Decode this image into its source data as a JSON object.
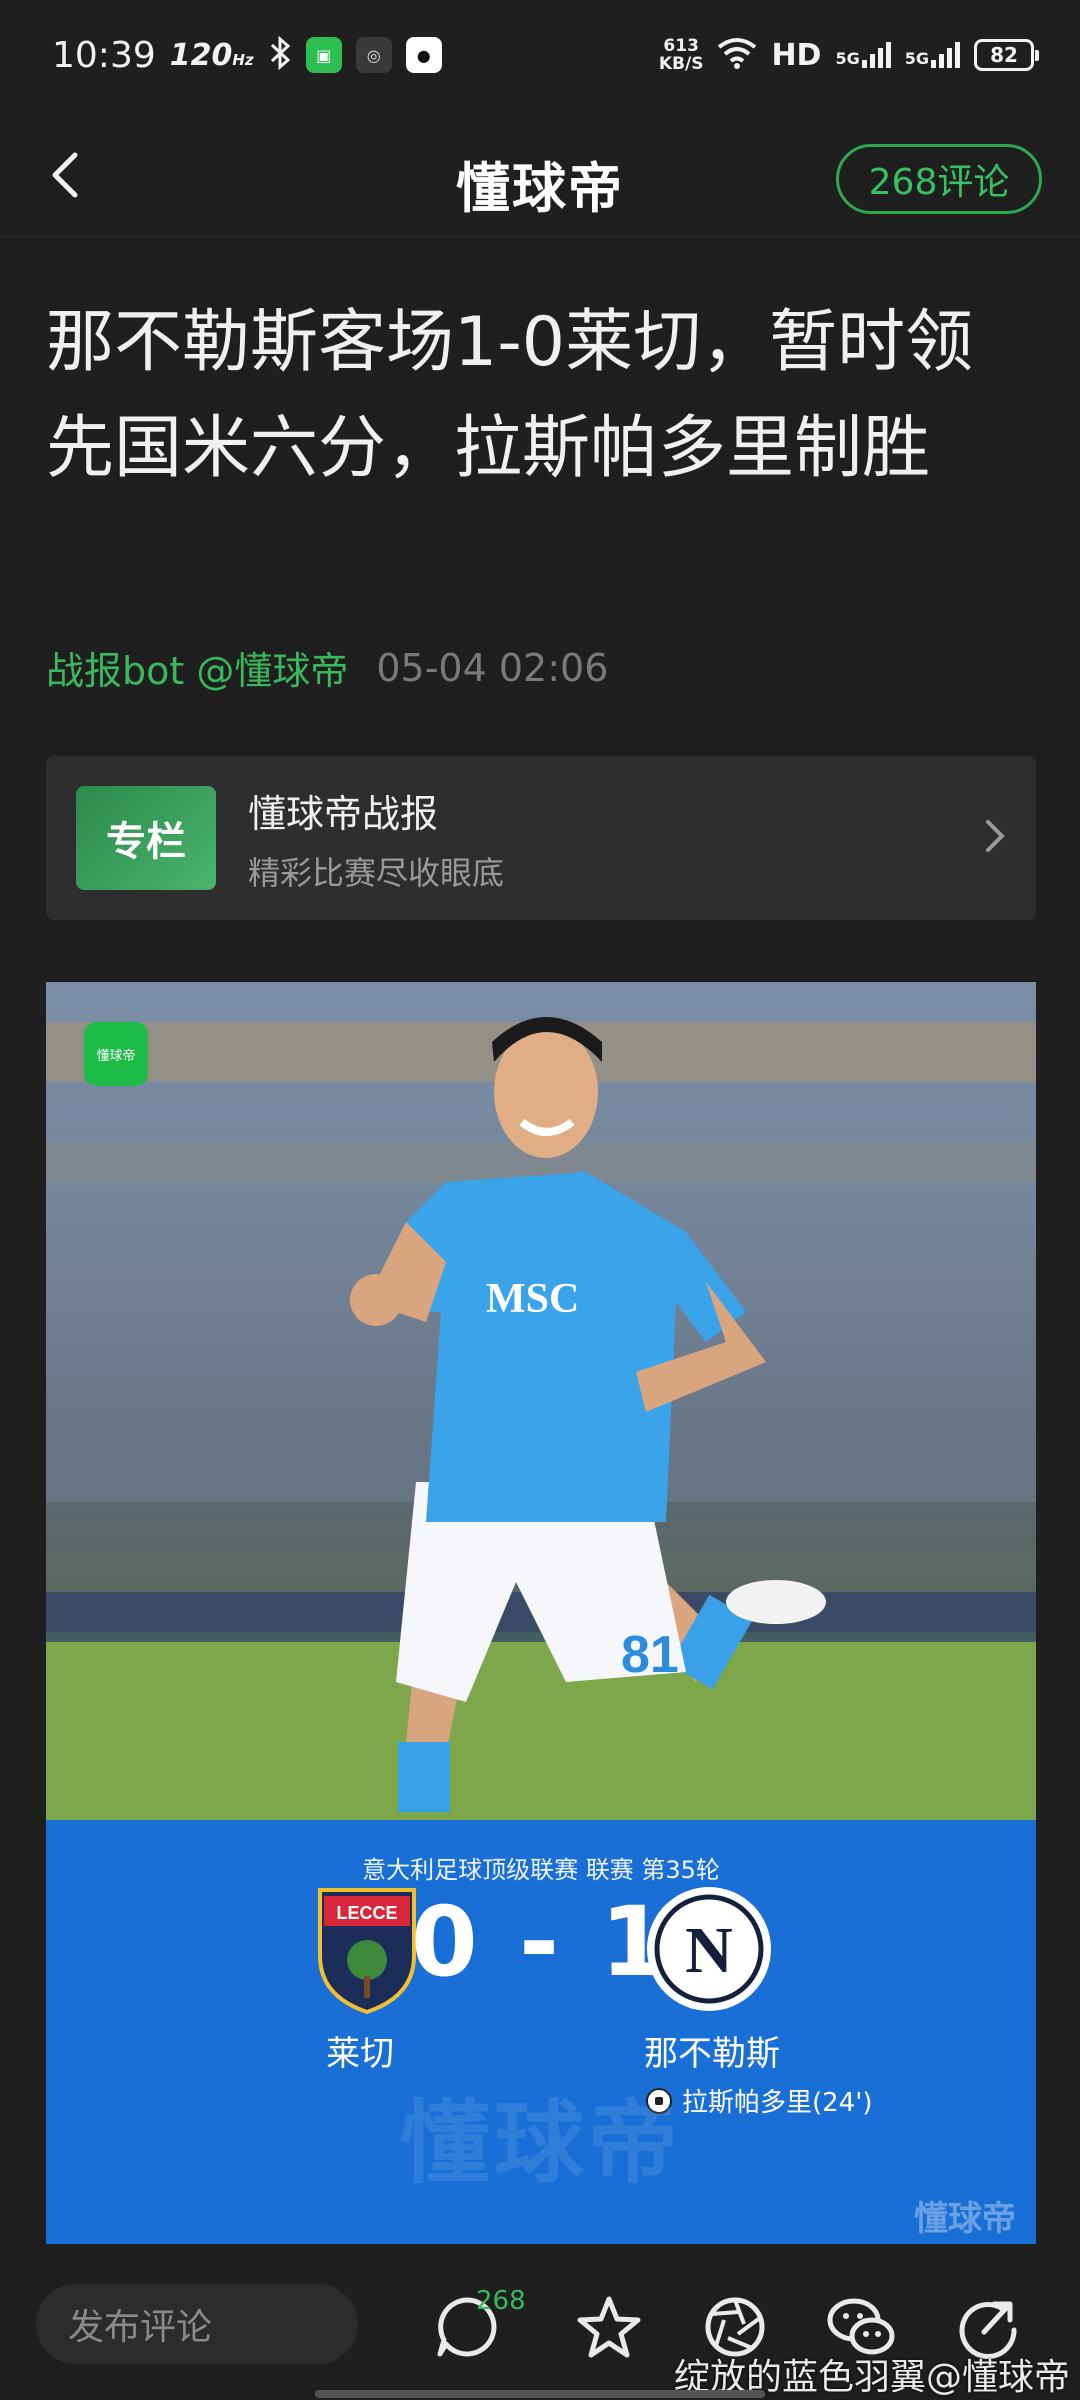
{
  "status_bar": {
    "time": "10:39",
    "refresh_rate": "120",
    "refresh_unit": "Hz",
    "net_speed_value": "613",
    "net_speed_unit": "KB/S",
    "hd_label": "HD",
    "network_1": "5G",
    "network_2": "5G",
    "battery": "82"
  },
  "header": {
    "logo": "懂球帝",
    "comment_button": "268评论"
  },
  "article": {
    "title": "那不勒斯客场1-0莱切，暂时领先国米六分，拉斯帕多里制胜",
    "author": "战报bot @懂球帝",
    "date": "05-04 02:06"
  },
  "column_card": {
    "icon_text": "专栏",
    "title": "懂球帝战报",
    "subtitle": "精彩比赛尽收眼底"
  },
  "hero": {
    "badge_text": "懂球帝",
    "competition": "意大利足球顶级联赛 联赛 第35轮",
    "home_team": "莱切",
    "home_badge_text": "LECCE",
    "away_team": "那不勒斯",
    "away_badge_text": "N",
    "score": "0 - 1",
    "scorer": "拉斯帕多里(24')",
    "shirt_sponsor": "MSC",
    "shirt_number": "81",
    "watermark": "懂球帝"
  },
  "bottom_bar": {
    "input_placeholder": "发布评论",
    "comment_count": "268"
  },
  "overlay_credit": "绽放的蓝色羽翼@懂球帝",
  "colors": {
    "accent_green": "#37c160",
    "background": "#1f1f1f",
    "scoreboard_blue": "#1a6fd6"
  }
}
